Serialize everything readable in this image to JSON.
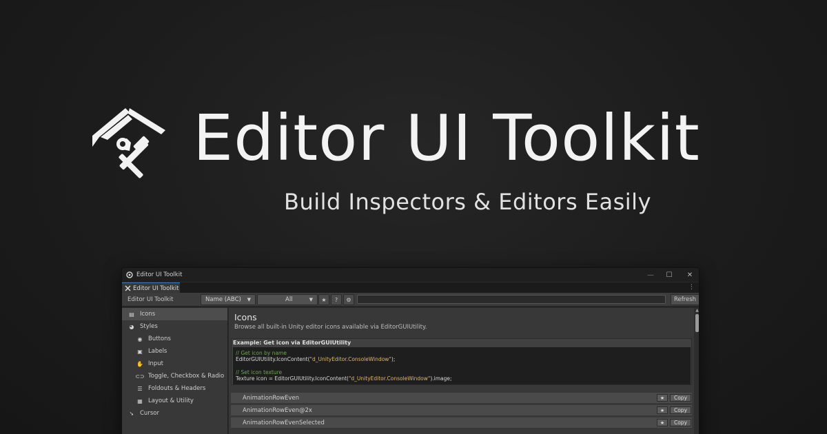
{
  "hero": {
    "title": "Editor UI Toolkit",
    "subtitle": "Build Inspectors & Editors Easily"
  },
  "window": {
    "title": "Editor UI Toolkit",
    "controls": {
      "minimize": "—",
      "maximize": "☐",
      "close": "✕"
    },
    "tab_label": "Editor UI Toolkit",
    "menu_glyph": "⋮"
  },
  "toolbar": {
    "label": "Editor UI Toolkit",
    "sort_dropdown": "Name (ABC)",
    "filter_dropdown": "All",
    "caret": "▼",
    "search_value": "",
    "refresh_label": "Refresh",
    "icons": [
      "star-icon",
      "help-icon",
      "gear-icon"
    ]
  },
  "sidebar": {
    "items": [
      {
        "label": "Icons",
        "icon": "image-icon",
        "level": 0,
        "selected": true
      },
      {
        "label": "Styles",
        "icon": "palette-icon",
        "level": 0,
        "selected": false
      },
      {
        "label": "Buttons",
        "icon": "radio-icon",
        "level": 1,
        "selected": false
      },
      {
        "label": "Labels",
        "icon": "text-icon",
        "level": 1,
        "selected": false
      },
      {
        "label": "Input",
        "icon": "hand-icon",
        "level": 1,
        "selected": false
      },
      {
        "label": "Toggle, Checkbox & Radio",
        "icon": "toggle-icon",
        "level": 1,
        "selected": false
      },
      {
        "label": "Foldouts & Headers",
        "icon": "list-icon",
        "level": 1,
        "selected": false
      },
      {
        "label": "Layout & Utility",
        "icon": "grid-icon",
        "level": 1,
        "selected": false
      },
      {
        "label": "Cursor",
        "icon": "cursor-icon",
        "level": 0,
        "selected": false
      }
    ]
  },
  "main": {
    "title": "Icons",
    "description": "Browse all built-in Unity editor icons available via EditorGUIUtility.",
    "example": {
      "heading": "Example: Get icon via EditorGUIUtility",
      "comment1": "// Get icon by name",
      "line1_pre": "EditorGUIUtility.IconContent(",
      "line1_str": "\"d_UnityEditor.ConsoleWindow\"",
      "line1_post": ");",
      "comment2": "// Set icon texture",
      "line2_pre": "Texture icon = EditorGUIUtility.IconContent(",
      "line2_str": "\"d_UnityEditor.ConsoleWindow\"",
      "line2_post": ").image;"
    },
    "rows": [
      {
        "name": "AnimationRowEven",
        "star": "★",
        "copy": "Copy"
      },
      {
        "name": "AnimationRowEven@2x",
        "star": "★",
        "copy": "Copy"
      },
      {
        "name": "AnimationRowEvenSelected",
        "star": "★",
        "copy": "Copy"
      }
    ]
  }
}
